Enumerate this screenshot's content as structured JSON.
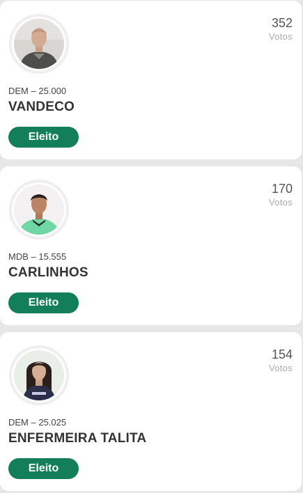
{
  "colors": {
    "badge": "#137f5a",
    "page_background": "#e7e7e7",
    "card": "#ffffff"
  },
  "candidates": [
    {
      "votes": "352",
      "votes_label": "Votos",
      "party": "DEM – 25.000",
      "name": "VANDECO",
      "status": "Eleito",
      "avatar_icon": "candidate-photo"
    },
    {
      "votes": "170",
      "votes_label": "Votos",
      "party": "MDB – 15.555",
      "name": "CARLINHOS",
      "status": "Eleito",
      "avatar_icon": "candidate-photo"
    },
    {
      "votes": "154",
      "votes_label": "Votos",
      "party": "DEM – 25.025",
      "name": "ENFERMEIRA TALITA",
      "status": "Eleito",
      "avatar_icon": "candidate-photo"
    }
  ]
}
